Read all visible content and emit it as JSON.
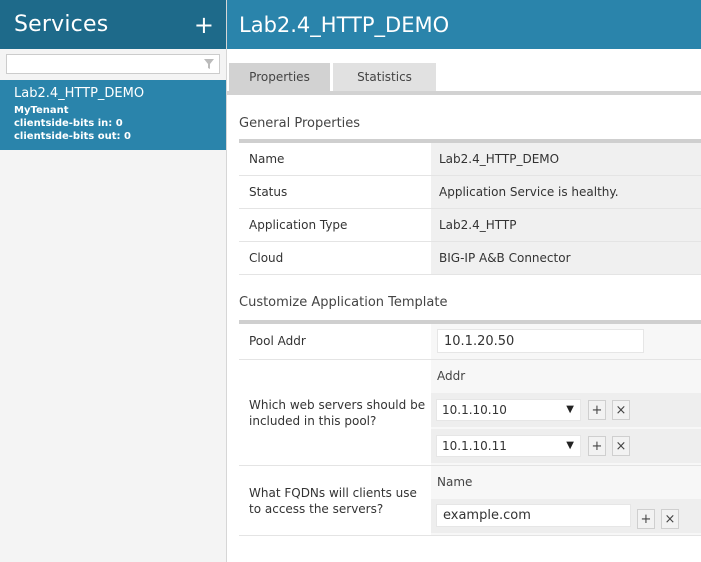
{
  "sidebar": {
    "title": "Services",
    "add_icon": "plus-icon",
    "filter": {
      "value": "",
      "placeholder": "",
      "icon": "funnel-icon"
    },
    "items": [
      {
        "name": "Lab2.4_HTTP_DEMO",
        "tenant": "MyTenant",
        "bits_in": "clientside-bits in: 0",
        "bits_out": "clientside-bits out: 0"
      }
    ]
  },
  "main": {
    "title": "Lab2.4_HTTP_DEMO",
    "tabs": [
      {
        "label": "Properties",
        "active": true
      },
      {
        "label": "Statistics",
        "active": false
      }
    ],
    "general": {
      "title": "General Properties",
      "rows": [
        {
          "label": "Name",
          "value": "Lab2.4_HTTP_DEMO"
        },
        {
          "label": "Status",
          "value": "Application Service is healthy."
        },
        {
          "label": "Application Type",
          "value": "Lab2.4_HTTP"
        },
        {
          "label": "Cloud",
          "value": "BIG-IP A&B Connector"
        }
      ]
    },
    "template": {
      "title": "Customize Application Template",
      "pool_addr": {
        "label": "Pool Addr",
        "value": "10.1.20.50"
      },
      "web_servers": {
        "label": "Which web servers should be included in this pool?",
        "column": "Addr",
        "rows": [
          {
            "value": "10.1.10.10"
          },
          {
            "value": "10.1.10.11"
          }
        ]
      },
      "fqdns": {
        "label": "What FQDNs will clients use to access the servers?",
        "column": "Name",
        "rows": [
          {
            "value": "example.com"
          }
        ]
      },
      "add_glyph": "+",
      "remove_glyph": "×",
      "dropdown_glyph": "▼"
    }
  },
  "colors": {
    "sidebar_header": "#1e6a8a",
    "main_header": "#2a84ab",
    "selected_item": "#2a84ab"
  }
}
